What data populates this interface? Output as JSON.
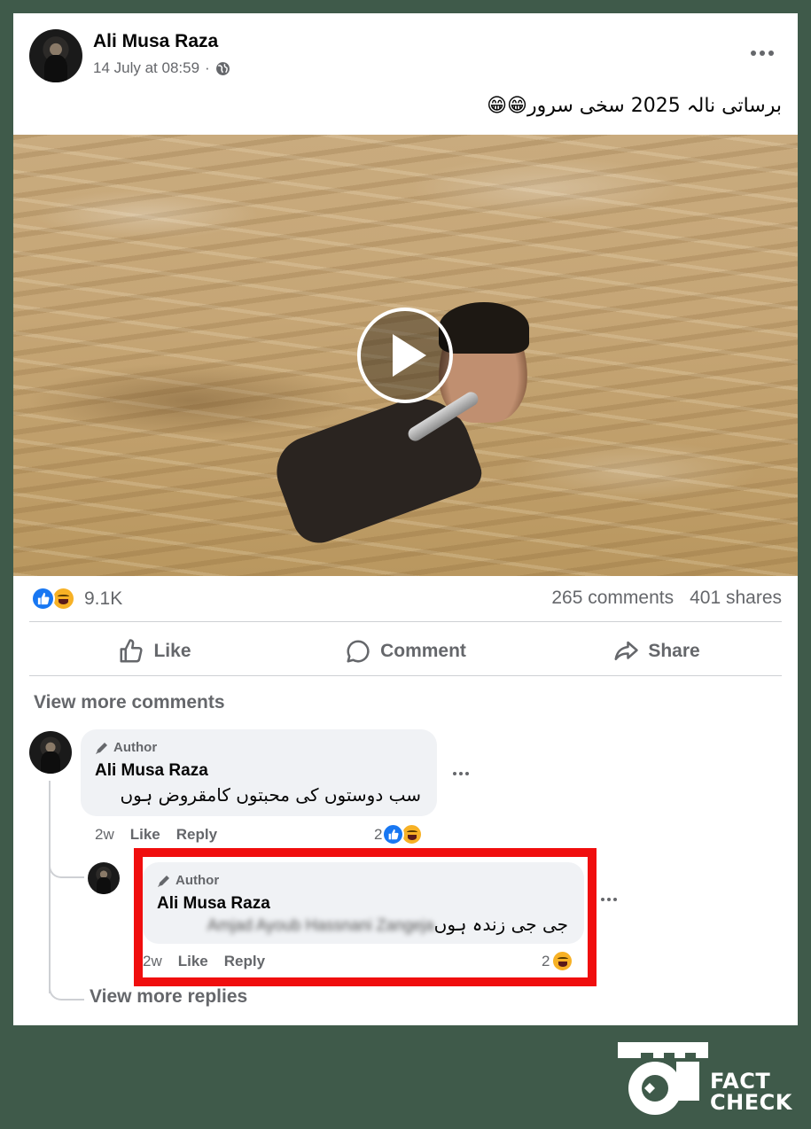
{
  "post": {
    "author_name": "Ali Musa Raza",
    "timestamp": "14 July at 08:59",
    "privacy_separator": "·",
    "privacy_icon": "globe-icon",
    "caption": "برساتی نالہ 2025 سخی سرور😁😁",
    "reaction_count": "9.1K",
    "comments_count": "265 comments",
    "shares_count": "401 shares"
  },
  "actions": {
    "like": "Like",
    "comment": "Comment",
    "share": "Share"
  },
  "comments": {
    "view_more": "View more comments",
    "view_more_replies": "View more replies",
    "items": [
      {
        "badge": "Author",
        "name": "Ali Musa Raza",
        "text": "سب دوستوں کی محبتوں کامقروض ہوں",
        "time": "2w",
        "like": "Like",
        "reply": "Reply",
        "reaction_count": "2"
      },
      {
        "badge": "Author",
        "name": "Ali Musa Raza",
        "mention": "Amjad Ayoub Hassnani Zangeja",
        "text": "جی جی زندہ ہوں",
        "time": "2w",
        "like": "Like",
        "reply": "Reply",
        "reaction_count": "2"
      }
    ]
  },
  "logo": {
    "line1": "FACT",
    "line2": "CHECK"
  },
  "colors": {
    "background": "#3f5a4a",
    "highlight": "#f00e0e",
    "like_blue": "#1877f2",
    "haha_yellow": "#f7b125"
  }
}
